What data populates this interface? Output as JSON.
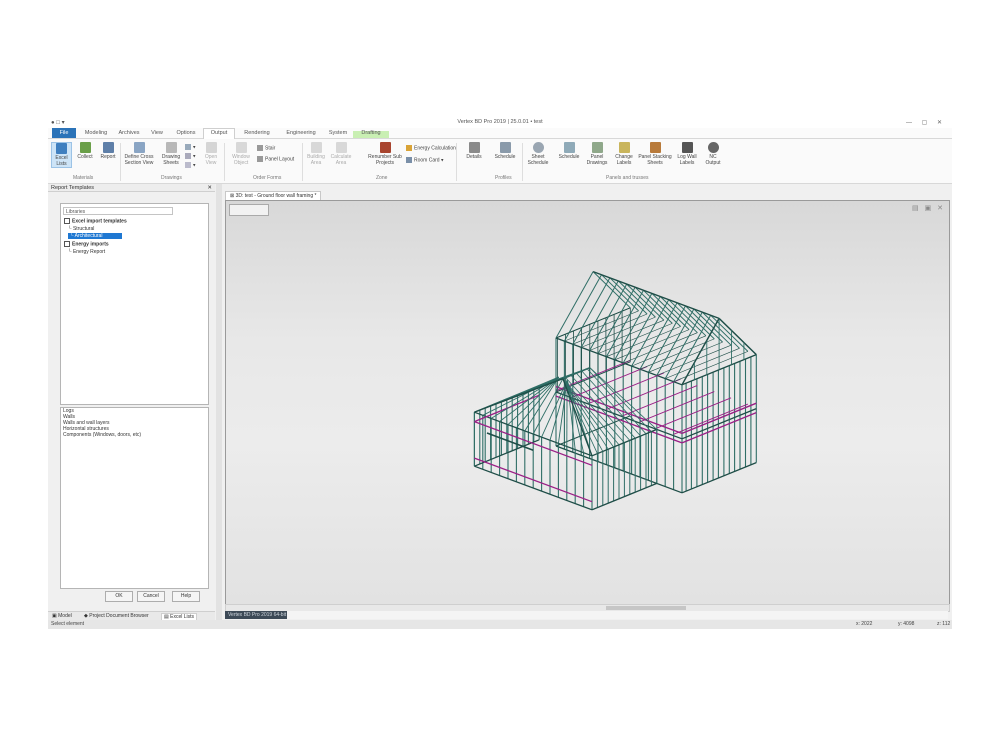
{
  "window": {
    "title": "Vertex BD Pro 2019 | 25.0.01 • test",
    "quick_access": "● □ ▾"
  },
  "tabs": [
    "File",
    "Modeling",
    "Archives",
    "View",
    "Options",
    "Output",
    "Rendering",
    "Engineering",
    "System",
    "Drafting"
  ],
  "ribbon": {
    "excel_lists": "Excel Lists",
    "collect": "Collect",
    "report": "Report",
    "define_cross_section_view": "Define Cross Section View",
    "drawing_sheets": "Drawing Sheets",
    "open_view": "Open View",
    "window_object": "Window Object",
    "stair": "Stair",
    "layout_plan": "Layout Plan",
    "panel_layout": "Panel Layout",
    "building_area": "Building Area",
    "calculate_area": "Calculate Area",
    "renumber_sub_projects": "Renumber Sub Projects",
    "energy_calculation": "Energy Calculation",
    "room_card": "Room Card",
    "details": "Details",
    "schedule": "Schedule",
    "sheet_schedule": "Sheet Schedule",
    "sub_schedule": "Schedule",
    "panel_drawings": "Panel Drawings",
    "change_labels": "Change Labels",
    "panel_stacking_sheets": "Panel Stacking Sheets",
    "log_wall_labels": "Log Wall Labels",
    "nc_output": "NC Output",
    "groups": {
      "materials": "Materials",
      "drawings": "Drawings",
      "other_forms": "Order Forms",
      "zone": "Zone",
      "profiles": "Profiles",
      "panels": "Panels and trusses"
    }
  },
  "left_panel": {
    "title": "Report Templates",
    "search": "Libraries",
    "tree": {
      "excel_templates": "Excel import templates",
      "structural": "Structural",
      "architectural": "Architectural",
      "energy_imports": "Energy imports",
      "energy_report": "Energy Report"
    },
    "description_lines": [
      "Logs",
      "Walls",
      "Walls and wall layers",
      "Horizontal structures",
      "Components (Windows, doors, etc)"
    ],
    "ok": "OK",
    "cancel": "Cancel",
    "help": "Help",
    "bottom_tabs": [
      "Model",
      "Project Document Browser",
      "Excel Lists"
    ]
  },
  "viewport": {
    "doc_tab": "3D: test - Ground floor wall framing *",
    "tools_icons": "▤ ▣ ✕",
    "coord_label": "Vertex BD Pro 2019 64-bit"
  },
  "statusbar": {
    "left": "Select element",
    "x": "x: 2022",
    "y": "y: 4098",
    "z": "z: 112"
  },
  "colors": {
    "frame": "#2f6e66",
    "frame_dark": "#1e4d47",
    "beam": "#9a1f86",
    "accent": "#2b73b8"
  }
}
